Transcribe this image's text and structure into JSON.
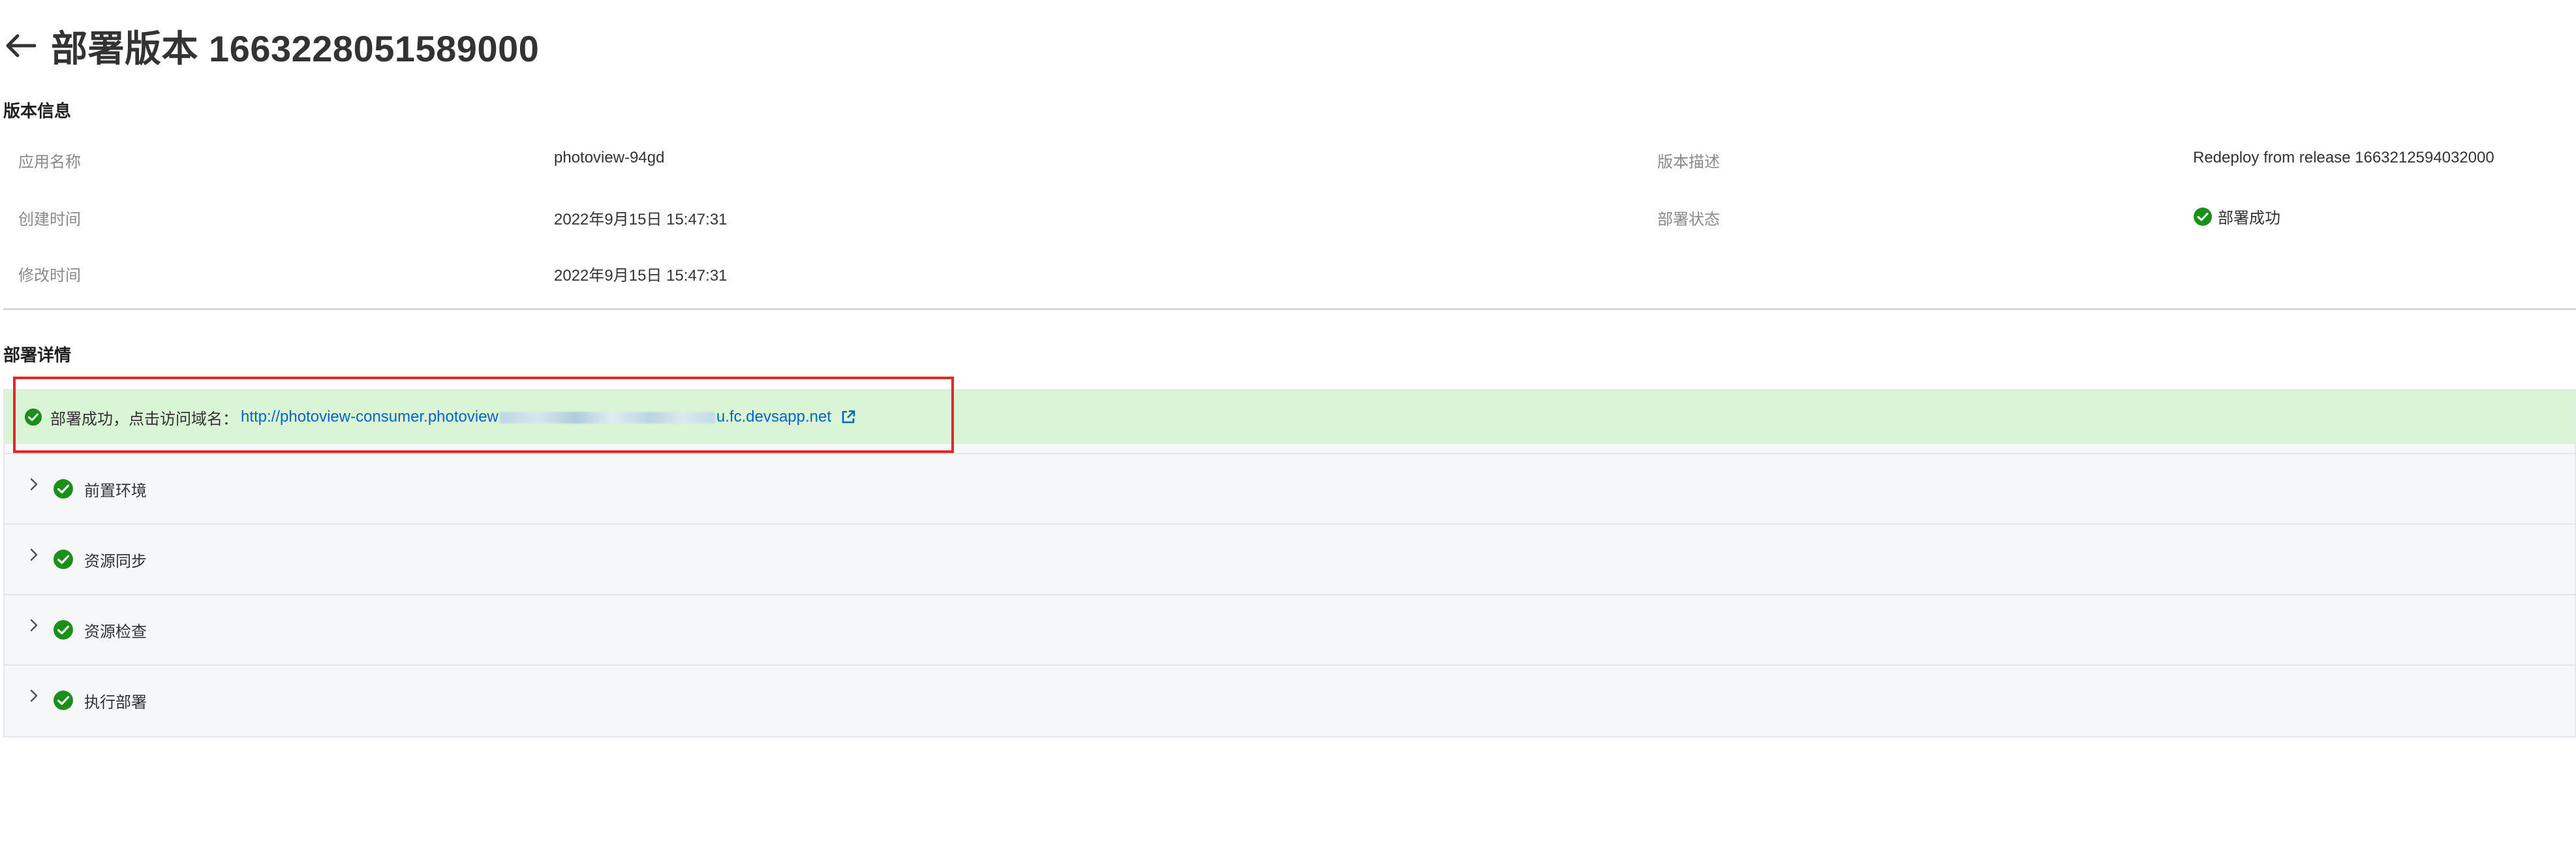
{
  "header": {
    "back_icon": "arrow-left-icon",
    "title": "部署版本 1663228051589000"
  },
  "version_info": {
    "section_title": "版本信息",
    "app_name_label": "应用名称",
    "app_name_value": "photoview-94gd",
    "description_label": "版本描述",
    "description_value": "Redeploy from release 1663212594032000",
    "created_label": "创建时间",
    "created_value": "2022年9月15日 15:47:31",
    "status_label": "部署状态",
    "status_value": "部署成功",
    "modified_label": "修改时间",
    "modified_value": "2022年9月15日 15:47:31"
  },
  "deploy_details": {
    "section_title": "部署详情",
    "success_text": "部署成功，点击访问域名：",
    "link_prefix": "http://photoview-consumer.photoview",
    "link_suffix": "u.fc.devsapp.net",
    "external_icon": "external-link-icon",
    "steps": [
      {
        "label": "前置环境"
      },
      {
        "label": "资源同步"
      },
      {
        "label": "资源检查"
      },
      {
        "label": "执行部署"
      }
    ]
  },
  "colors": {
    "success_green": "#1a8f1a",
    "success_bg": "#d9f5d6",
    "link_blue": "#0064c8",
    "highlight_red": "#e0282e"
  }
}
